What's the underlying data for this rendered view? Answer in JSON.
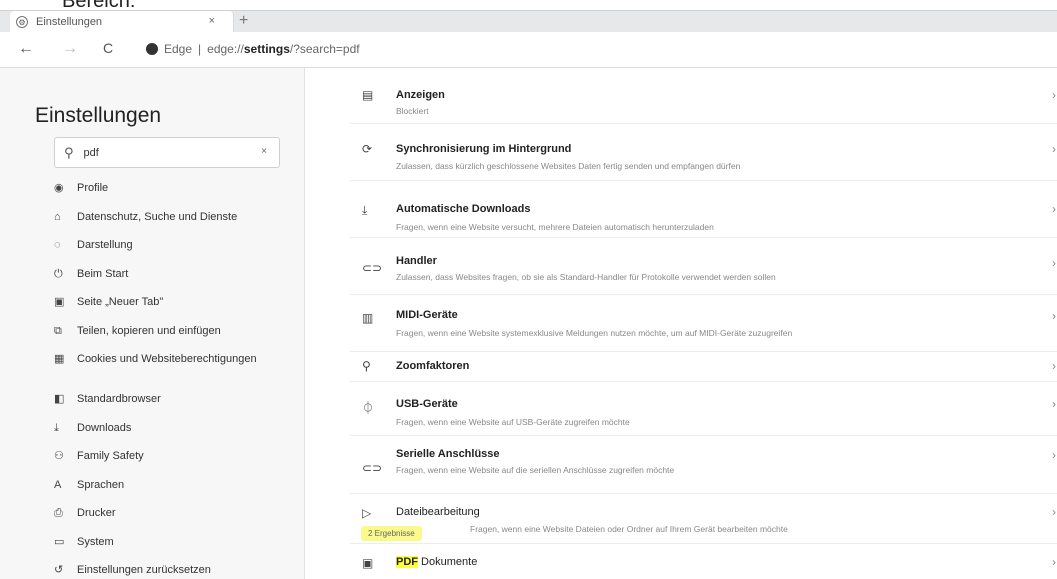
{
  "overlay_text": "Bereich:",
  "tab": {
    "title": "Einstellungen",
    "close": "×",
    "new_tab": "+"
  },
  "address": {
    "back": "←",
    "forward": "→",
    "reload": "C",
    "brand": "Edge",
    "separator": "|",
    "url_prefix": "edge://",
    "url_bold": "settings",
    "url_suffix": "/?search=pdf"
  },
  "sidebar": {
    "title": "Einstellungen",
    "search": {
      "value": "pdf",
      "clear": "×"
    },
    "items": [
      {
        "label": "Profile",
        "icon": "person-icon"
      },
      {
        "label": "Datenschutz, Suche und Dienste",
        "icon": "lock-icon"
      },
      {
        "label": "Darstellung",
        "icon": "palette-icon"
      },
      {
        "label": "Beim Start",
        "icon": "power-icon"
      },
      {
        "label": "Seite „Neuer Tab\"",
        "icon": "newtab-icon"
      },
      {
        "label": "Teilen, kopieren und einfügen",
        "icon": "share-icon"
      },
      {
        "label": "Cookies und Websiteberechtigungen",
        "icon": "cookie-icon"
      },
      {
        "label": "Standardbrowser",
        "icon": "browser-icon"
      },
      {
        "label": "Downloads",
        "icon": "download-icon"
      },
      {
        "label": "Family Safety",
        "icon": "family-icon"
      },
      {
        "label": "Sprachen",
        "icon": "language-icon"
      },
      {
        "label": "Drucker",
        "icon": "printer-icon"
      },
      {
        "label": "System",
        "icon": "system-icon"
      },
      {
        "label": "Einstellungen zurücksetzen",
        "icon": "reset-icon"
      }
    ]
  },
  "content": {
    "rows": [
      {
        "title": "Anzeigen",
        "desc": "Blockiert",
        "icon": "ads-icon"
      },
      {
        "title": "Synchronisierung im Hintergrund",
        "desc": "Zulassen, dass kürzlich geschlossene Websites Daten fertig senden und empfangen dürfen",
        "icon": "sync-icon"
      },
      {
        "title": "Automatische Downloads",
        "desc": "Fragen, wenn eine Website versucht, mehrere Dateien automatisch herunterzuladen",
        "icon": "download-icon"
      },
      {
        "title": "Handler",
        "desc": "Zulassen, dass Websites fragen, ob sie als Standard-Handler für Protokolle verwendet werden sollen",
        "icon": "link-icon"
      },
      {
        "title": "MIDI-Geräte",
        "desc": "Fragen, wenn eine Website systemexklusive Meldungen nutzen möchte, um auf MIDI-Geräte zuzugreifen",
        "icon": "midi-icon"
      },
      {
        "title": "Zoomfaktoren",
        "desc": "",
        "icon": "zoom-icon"
      },
      {
        "title": "USB-Geräte",
        "desc": "Fragen, wenn eine Website auf USB-Geräte zugreifen möchte",
        "icon": "usb-icon"
      },
      {
        "title": "Serielle Anschlüsse",
        "desc": "Fragen, wenn eine Website auf die seriellen Anschlüsse zugreifen möchte",
        "icon": "serial-icon"
      },
      {
        "title": "Dateibearbeitung",
        "desc": "Fragen, wenn eine Website Dateien oder Ordner auf Ihrem Gerät bearbeiten möchte",
        "icon": "file-edit-icon"
      }
    ],
    "pdf_row": {
      "highlight": "PDF",
      "title_rest": " Dokumente",
      "icon": "pdf-icon"
    },
    "results_badge": "2 Ergebnisse",
    "chevron": "›"
  }
}
